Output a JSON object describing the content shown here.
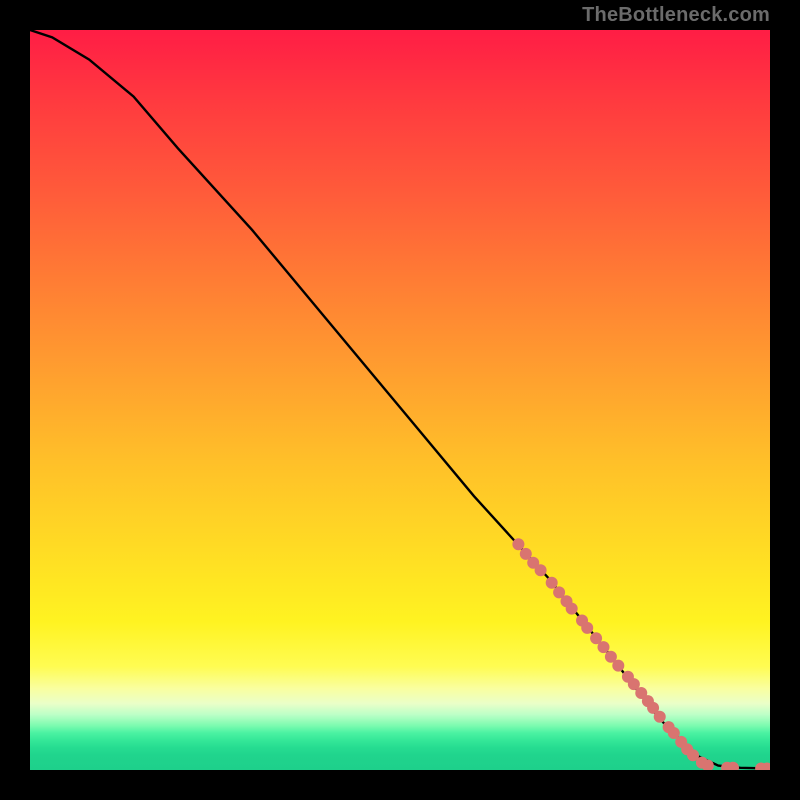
{
  "watermark": "TheBottleneck.com",
  "chart_data": {
    "type": "line",
    "title": "",
    "xlabel": "",
    "ylabel": "",
    "xlim": [
      0,
      100
    ],
    "ylim": [
      0,
      100
    ],
    "background": "vertical_gradient_red_to_green",
    "curve": {
      "description": "Monotone decreasing curve from near (0,100) to (100,0), slight concavity at start then near-linear, flattening to 0 near the right edge.",
      "points": [
        {
          "x": 0,
          "y": 100
        },
        {
          "x": 3,
          "y": 99
        },
        {
          "x": 8,
          "y": 96
        },
        {
          "x": 14,
          "y": 91
        },
        {
          "x": 20,
          "y": 84
        },
        {
          "x": 30,
          "y": 73
        },
        {
          "x": 40,
          "y": 61
        },
        {
          "x": 50,
          "y": 49
        },
        {
          "x": 60,
          "y": 37
        },
        {
          "x": 70,
          "y": 26
        },
        {
          "x": 78,
          "y": 16
        },
        {
          "x": 85,
          "y": 7
        },
        {
          "x": 90,
          "y": 2
        },
        {
          "x": 93,
          "y": 0.6
        },
        {
          "x": 96,
          "y": 0.3
        },
        {
          "x": 100,
          "y": 0.2
        }
      ]
    },
    "markers": {
      "color": "#d97470",
      "radius_px": 6,
      "points": [
        {
          "x": 66,
          "y": 30.5
        },
        {
          "x": 67,
          "y": 29.2
        },
        {
          "x": 68,
          "y": 28.0
        },
        {
          "x": 69,
          "y": 27.0
        },
        {
          "x": 70.5,
          "y": 25.3
        },
        {
          "x": 71.5,
          "y": 24.0
        },
        {
          "x": 72.5,
          "y": 22.8
        },
        {
          "x": 73.2,
          "y": 21.8
        },
        {
          "x": 74.6,
          "y": 20.2
        },
        {
          "x": 75.3,
          "y": 19.2
        },
        {
          "x": 76.5,
          "y": 17.8
        },
        {
          "x": 77.5,
          "y": 16.6
        },
        {
          "x": 78.5,
          "y": 15.3
        },
        {
          "x": 79.5,
          "y": 14.1
        },
        {
          "x": 80.8,
          "y": 12.6
        },
        {
          "x": 81.6,
          "y": 11.6
        },
        {
          "x": 82.6,
          "y": 10.4
        },
        {
          "x": 83.5,
          "y": 9.3
        },
        {
          "x": 84.2,
          "y": 8.4
        },
        {
          "x": 85.1,
          "y": 7.2
        },
        {
          "x": 86.3,
          "y": 5.8
        },
        {
          "x": 87.0,
          "y": 5.0
        },
        {
          "x": 88.0,
          "y": 3.8
        },
        {
          "x": 88.8,
          "y": 2.8
        },
        {
          "x": 89.6,
          "y": 2.0
        },
        {
          "x": 90.8,
          "y": 1.0
        },
        {
          "x": 91.6,
          "y": 0.6
        },
        {
          "x": 94.2,
          "y": 0.3
        },
        {
          "x": 95.0,
          "y": 0.3
        },
        {
          "x": 98.8,
          "y": 0.2
        },
        {
          "x": 99.6,
          "y": 0.2
        }
      ]
    }
  }
}
